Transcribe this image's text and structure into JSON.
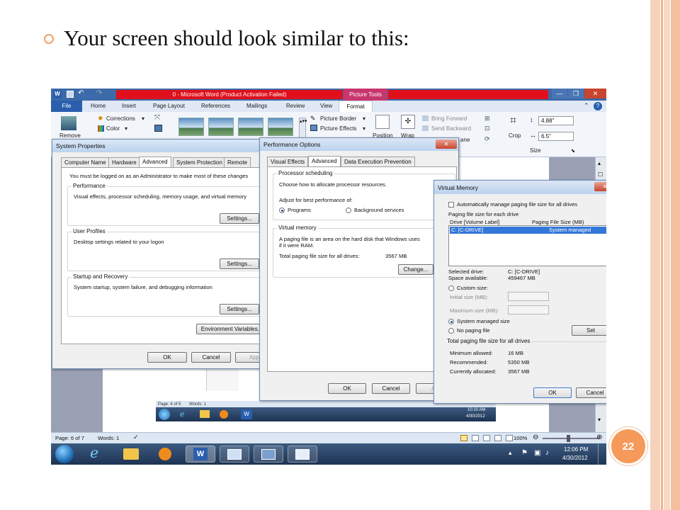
{
  "slide": {
    "heading": "Your screen should look similar to this:",
    "page_number": "22"
  },
  "word": {
    "title": "0 - Microsoft Word (Product Activation Failed)",
    "context_tab": "Picture Tools",
    "tabs": [
      "File",
      "Home",
      "Insert",
      "Page Layout",
      "References",
      "Mailings",
      "Review",
      "View",
      "Format"
    ],
    "ribbon": {
      "remove_label": "Remove",
      "corrections": "Corrections",
      "color": "Color",
      "picture_border": "Picture Border",
      "picture_effects": "Picture Effects",
      "position": "Position",
      "wrap": "Wrap",
      "bring_forward": "Bring Forward",
      "send_backward": "Send Backward",
      "pane": "ane",
      "crop": "Crop",
      "height_value": "4.88\"",
      "width_value": "6.5\"",
      "size_group": "Size"
    },
    "status": {
      "page": "Page: 6 of 7",
      "words": "Words: 1",
      "zoom": "100%"
    },
    "clock": {
      "time": "12:06 PM",
      "date": "4/30/2012"
    },
    "inner_clock": {
      "time": "10:10 AM",
      "date": "4/30/2012"
    },
    "inner_status": {
      "page": "Page: 4 of 5",
      "words": "Words: 1"
    }
  },
  "system_properties": {
    "title": "System Properties",
    "tabs": [
      "Computer Name",
      "Hardware",
      "Advanced",
      "System Protection",
      "Remote"
    ],
    "admin_note": "You must be logged on as an Administrator to make most of these changes",
    "performance_label": "Performance",
    "performance_desc": "Visual effects, processor scheduling, memory usage, and virtual memory",
    "user_profiles_label": "User Profiles",
    "user_profiles_desc": "Desktop settings related to your logon",
    "startup_label": "Startup and Recovery",
    "startup_desc": "System startup, system failure, and debugging information",
    "settings_btn": "Settings...",
    "env_btn": "Environment Variables...",
    "ok": "OK",
    "cancel": "Cancel",
    "apply": "Appl"
  },
  "performance_options": {
    "title": "Performance Options",
    "tabs": [
      "Visual Effects",
      "Advanced",
      "Data Execution Prevention"
    ],
    "processor_label": "Processor scheduling",
    "processor_desc": "Choose how to allocate processor resources.",
    "adjust_label": "Adjust for best performance of:",
    "programs": "Programs",
    "background": "Background services",
    "vm_label": "Virtual memory",
    "vm_desc1": "A paging file is an area on the hard disk that Windows uses",
    "vm_desc2": "if it were RAM.",
    "total_label": "Total paging file size for all drives:",
    "total_value": "3567 MB",
    "change_btn": "Change...",
    "ok": "OK",
    "cancel": "Cancel",
    "apply": "Ap"
  },
  "virtual_memory": {
    "title": "Virtual Memory",
    "auto_manage": "Automatically manage paging file size for all drives",
    "each_drive": "Paging file size for each drive",
    "col_drive": "Drive  [Volume Label]",
    "col_size": "Paging File Size (MB)",
    "row_drive": "C:      [C-DRIVE]",
    "row_size": "System managed",
    "selected_drive_label": "Selected drive:",
    "selected_drive_value": "C:  [C-DRIVE]",
    "space_label": "Space available:",
    "space_value": "459467 MB",
    "custom_size": "Custom size:",
    "initial_size": "Initial size (MB):",
    "maximum_size": "Maximum size (MB):",
    "system_managed": "System managed size",
    "no_paging": "No paging file",
    "set_btn": "Set",
    "total_label": "Total paging file size for all drives",
    "min_label": "Minimum allowed:",
    "min_value": "16 MB",
    "rec_label": "Recommended:",
    "rec_value": "5350 MB",
    "cur_label": "Currently allocated:",
    "cur_value": "3567 MB",
    "ok": "OK",
    "cancel": "Cancel"
  },
  "colors": {
    "accent_orange": "#f59a5a",
    "activation_red": "#e0101c",
    "selection_blue": "#3377d8"
  }
}
